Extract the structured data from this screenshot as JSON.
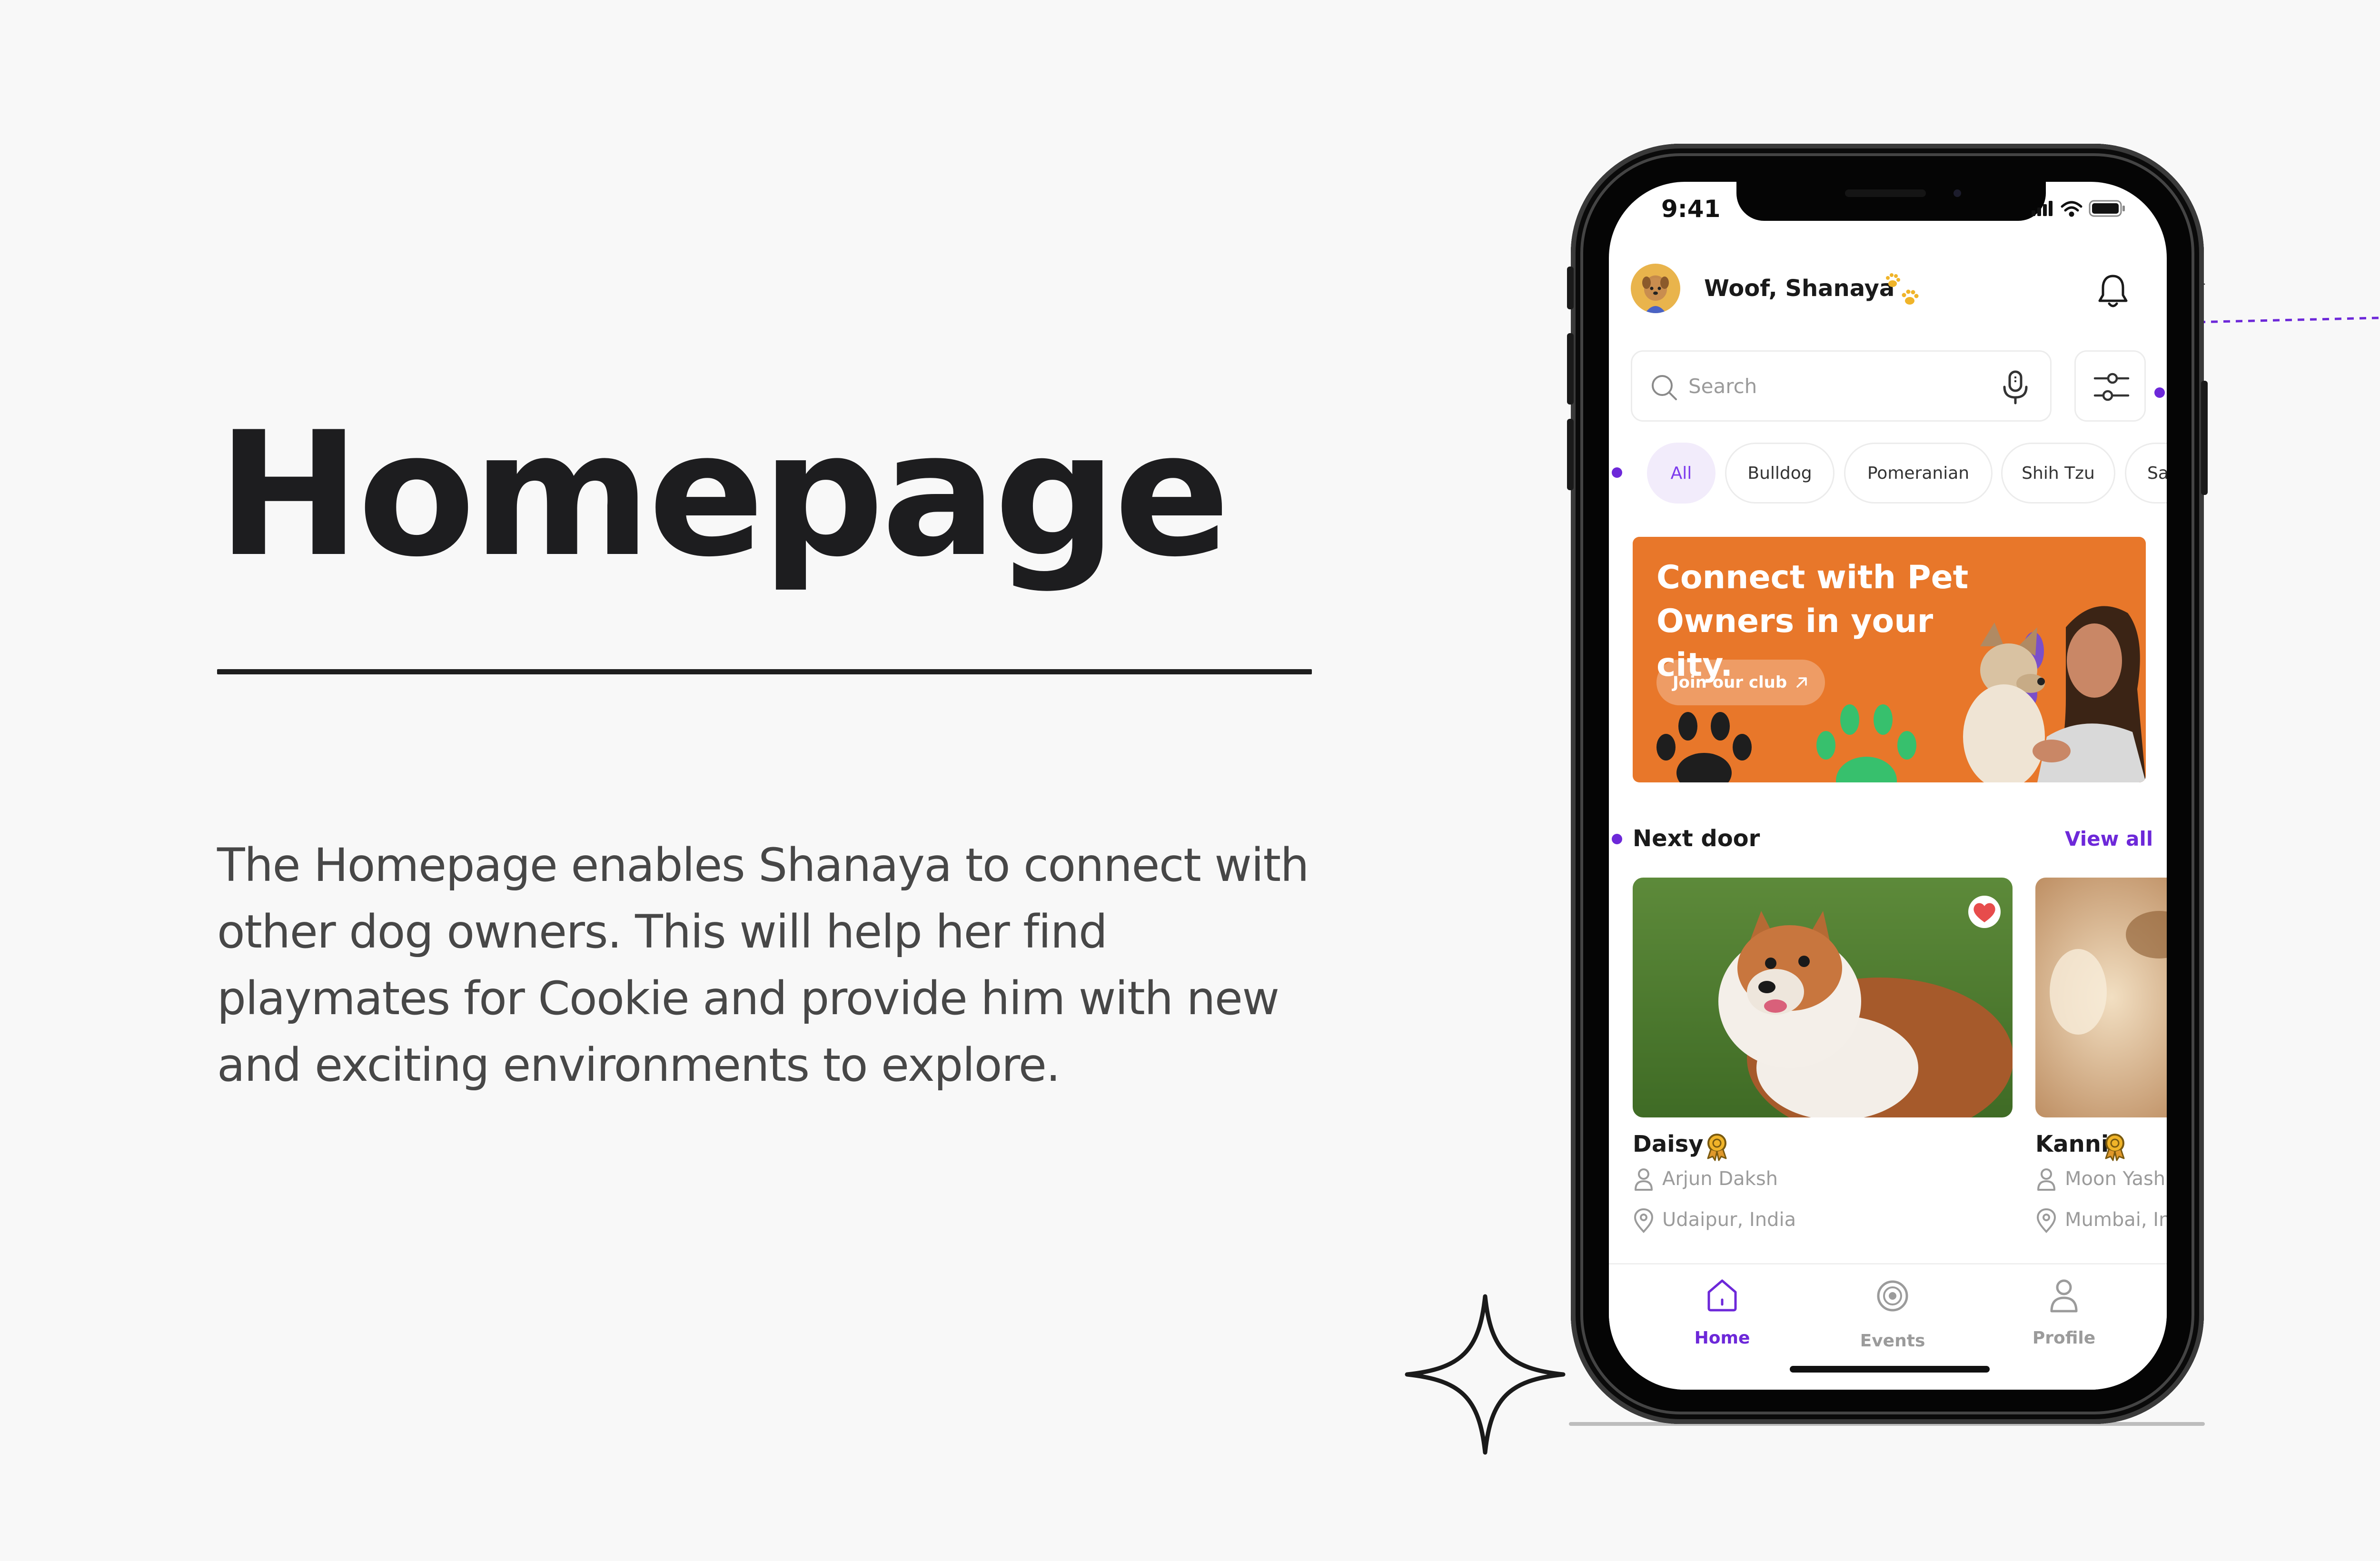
{
  "heading": "Homepage",
  "description": "The Homepage enables Shanaya to connect with other dog owners. This will help her find playmates for Cookie and provide him with new and exciting environments to explore.",
  "phone": {
    "status_time": "9:41",
    "greeting": "Woof, Shanaya",
    "search_placeholder": "Search",
    "chips": [
      {
        "label": "All",
        "active": true
      },
      {
        "label": "Bulldog"
      },
      {
        "label": "Pomeranian"
      },
      {
        "label": "Shih Tzu"
      },
      {
        "label": "Samoyed"
      }
    ],
    "banner": {
      "title_line1": "Connect with Pet",
      "title_line2": "Owners in your city.",
      "button_label": "Join our club"
    },
    "section_title": "Next door",
    "view_all_label": "View all",
    "dogs": [
      {
        "name": "Daisy",
        "owner": "Arjun Daksh",
        "location": "Udaipur, India",
        "favorited": true
      },
      {
        "name": "Kanni",
        "owner": "Moon Yash",
        "location": "Mumbai, India"
      }
    ],
    "nav": [
      {
        "label": "Home",
        "icon": "home-icon",
        "active": true
      },
      {
        "label": "Events",
        "icon": "events-icon"
      },
      {
        "label": "Profile",
        "icon": "profile-icon"
      }
    ]
  },
  "colors": {
    "accent_purple": "#6d28d9",
    "banner_orange": "#e8772a",
    "paw_green": "#37c06d"
  }
}
